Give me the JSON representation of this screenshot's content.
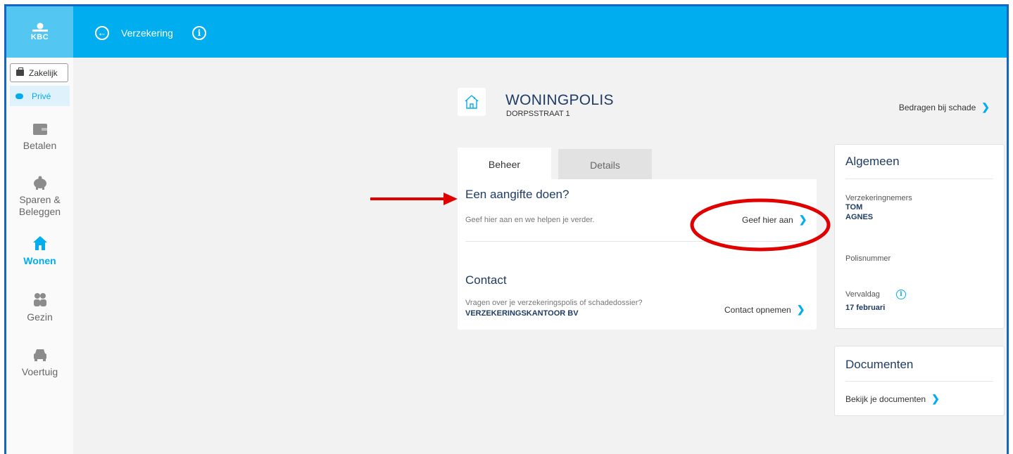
{
  "header": {
    "logo_text": "KBC",
    "title": "Verzekering"
  },
  "sidebar": {
    "toggle": {
      "business_label": "Zakelijk",
      "private_label": "Privé"
    },
    "items": [
      {
        "label": "Betalen",
        "icon": "wallet-icon"
      },
      {
        "label": "Sparen & Beleggen",
        "icon": "piggy-bank-icon"
      },
      {
        "label": "Wonen",
        "icon": "house-icon",
        "active": true
      },
      {
        "label": "Gezin",
        "icon": "people-icon"
      },
      {
        "label": "Voertuig",
        "icon": "car-icon"
      }
    ]
  },
  "policy": {
    "title": "WONINGPOLIS",
    "address": "DORPSSTRAAT 1",
    "damage_link": "Bedragen bij schade"
  },
  "tabs": {
    "beheer": "Beheer",
    "details": "Details"
  },
  "claim": {
    "title": "Een aangifte doen?",
    "description": "Geef hier aan en we helpen je verder.",
    "action": "Geef hier aan"
  },
  "contact": {
    "title": "Contact",
    "question": "Vragen over je verzekeringspolis of schadedossier?",
    "office": "VERZEKERINGSKANTOOR BV",
    "action": "Contact opnemen"
  },
  "general": {
    "title": "Algemeen",
    "policyholders_label": "Verzekeringnemers",
    "policyholder_1": "TOM",
    "policyholder_2": "AGNES",
    "policy_number_label": "Polisnummer",
    "due_label": "Vervaldag",
    "due_value": "17 februari"
  },
  "documents": {
    "title": "Documenten",
    "link": "Bekijk je documenten"
  },
  "colors": {
    "header_blue": "#00aeef",
    "navy_text": "#1f3c64",
    "annotation_red": "#e00000"
  }
}
